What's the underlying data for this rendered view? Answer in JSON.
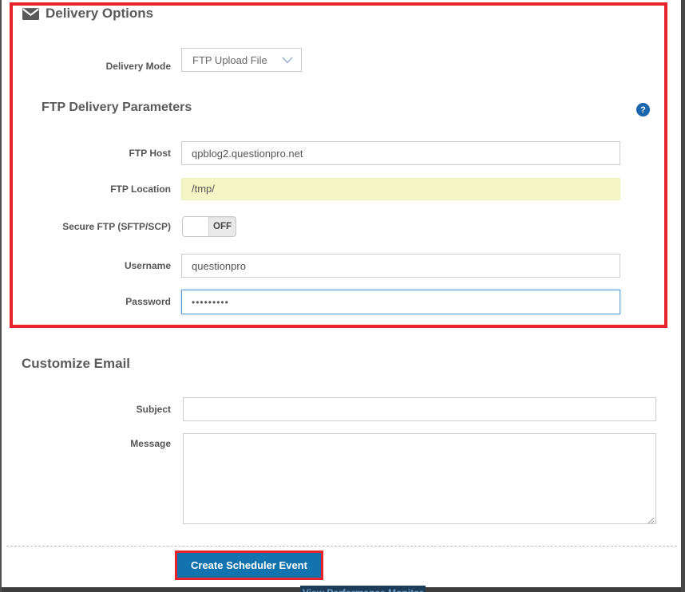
{
  "delivery_options": {
    "header": "Delivery Options",
    "delivery_mode_label": "Delivery Mode",
    "delivery_mode_value": "FTP Upload File"
  },
  "ftp_parameters": {
    "header": "FTP Delivery Parameters",
    "help_icon": "question-mark-icon",
    "ftp_host_label": "FTP Host",
    "ftp_host_value": "qpblog2.questionpro.net",
    "ftp_location_label": "FTP Location",
    "ftp_location_value": "/tmp/",
    "secure_ftp_label": "Secure FTP (SFTP/SCP)",
    "secure_ftp_state": "OFF",
    "username_label": "Username",
    "username_value": "questionpro",
    "password_label": "Password",
    "password_value": "•••••••••"
  },
  "customize_email": {
    "header": "Customize Email",
    "subject_label": "Subject",
    "subject_value": "",
    "message_label": "Message",
    "message_value": ""
  },
  "footer": {
    "create_button_label": "Create Scheduler Event",
    "partial_bottom_button_label": "View Performance Monitor"
  },
  "colors": {
    "annotation_red": "#e8232a",
    "button_blue": "#1273ae",
    "highlight_yellow": "#f5f6c6",
    "focus_blue": "#5f9fd6",
    "help_blue": "#1a67ad"
  }
}
